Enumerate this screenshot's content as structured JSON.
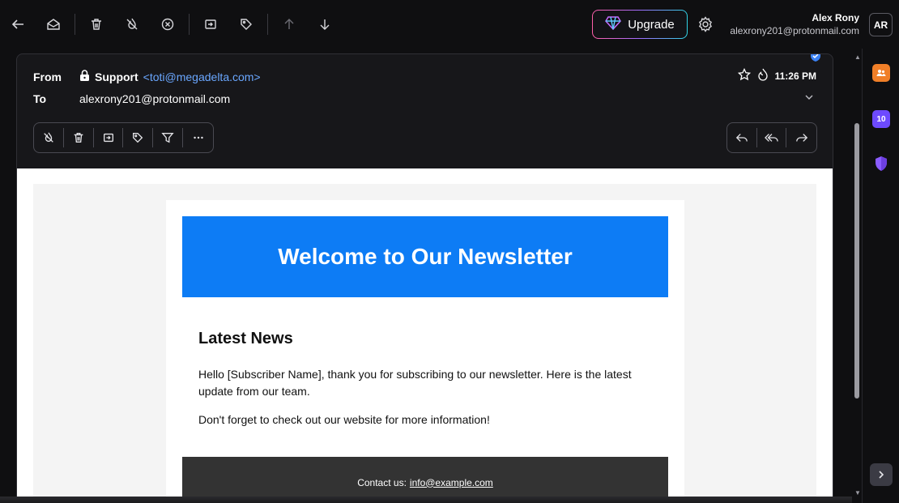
{
  "toolbar": {
    "icons": [
      "back-arrow-icon",
      "envelope-open-icon",
      "trash-icon",
      "fire-slash-icon",
      "close-circle-icon",
      "move-to-folder-icon",
      "tag-icon",
      "arrow-up-icon",
      "arrow-down-icon"
    ],
    "upgrade_label": "Upgrade",
    "user_name": "Alex Rony",
    "user_email": "alexrony201@protonmail.com",
    "avatar_initials": "AR"
  },
  "message": {
    "from_label": "From",
    "to_label": "To",
    "sender_name": "Support",
    "sender_address": "<toti@megadelta.com>",
    "recipient": "alexrony201@protonmail.com",
    "time": "11:26 PM",
    "actions_left": [
      "fire-slash-icon",
      "trash-icon",
      "move-to-folder-icon",
      "tag-icon",
      "filter-icon",
      "more-icon"
    ],
    "actions_right": [
      "reply-icon",
      "reply-all-icon",
      "forward-icon"
    ]
  },
  "newsletter": {
    "header_title": "Welcome to Our Newsletter",
    "section_title": "Latest News",
    "paragraph_1": "Hello [Subscriber Name], thank you for subscribing to our newsletter. Here is the latest update from our team.",
    "paragraph_2": "Don't forget to check out our website for more information!",
    "footer_label": "Contact us:",
    "footer_email": "info@example.com",
    "header_color": "#0d7cf5",
    "footer_color": "#333333"
  },
  "rail": {
    "apps": [
      "contacts-icon",
      "calendar-icon",
      "vpn-shield-icon"
    ],
    "calendar_day": "10"
  }
}
